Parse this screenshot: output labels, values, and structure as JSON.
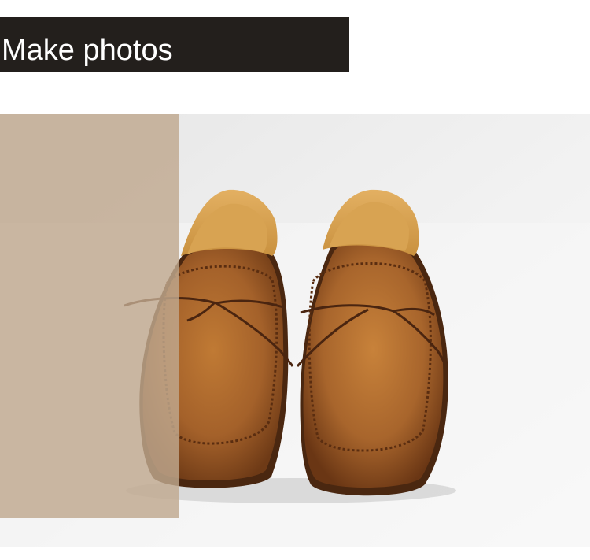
{
  "header": {
    "title": "Make photos"
  },
  "colors": {
    "banner_background": "#231f1c",
    "banner_text": "#ffffff",
    "overlay_tan": "#bfa88f",
    "leather_brown": "#9a5a24"
  },
  "photo": {
    "subject_icon": "brown-leather-loafers-pair"
  }
}
